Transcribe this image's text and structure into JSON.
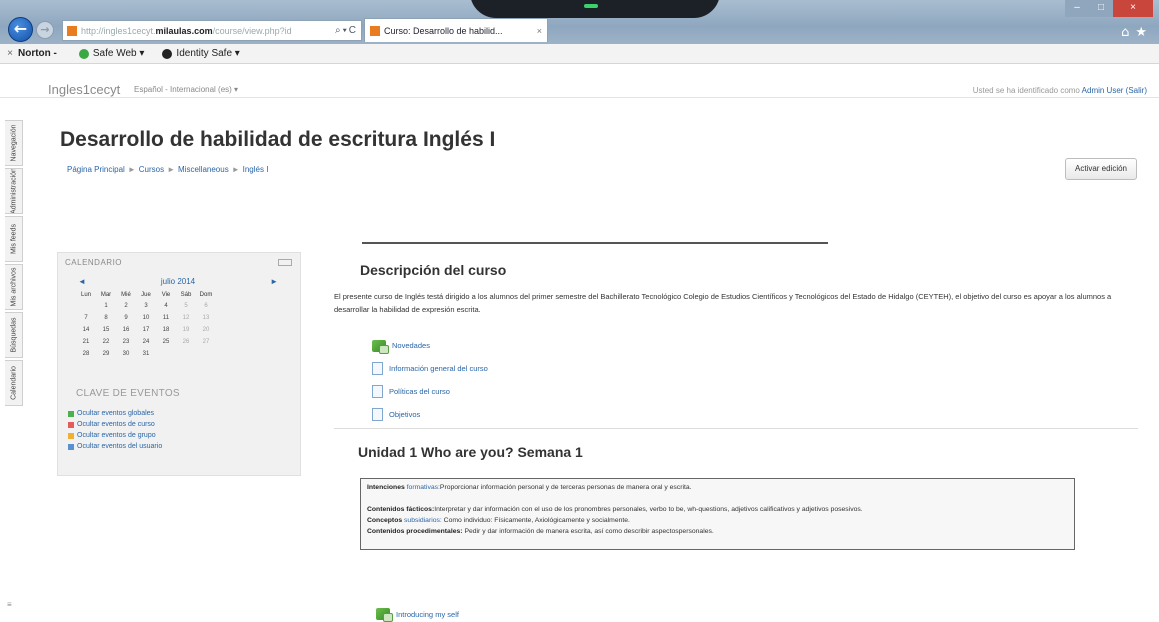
{
  "browser": {
    "address": {
      "scheme": "http://",
      "host_pre": "ingles1cecyt.",
      "host": "milaulas.com",
      "path": "/course/view.php?id"
    },
    "tab_title": "Curso: Desarrollo de habilid...",
    "toolbar": {
      "norton_label": "Norton -",
      "safe_web_label": "Safe Web ▾",
      "identity_safe_label": "Identity Safe ▾"
    }
  },
  "site": {
    "name": "Ingles1cecyt",
    "language": "Español - Internacional (es) ▾",
    "login_text": "Usted se ha identificado como ",
    "login_user": "Admin User (Salir)"
  },
  "dock": {
    "items": [
      "Navegación",
      "Administración",
      "Mis feeds",
      "Mis archivos",
      "Búsquedas",
      "Calendario"
    ],
    "bottom": "≡"
  },
  "course": {
    "title": "Desarrollo de habilidad de escritura Inglés I",
    "breadcrumb": [
      "Página Principal",
      "Cursos",
      "Miscellaneous",
      "Inglés I"
    ],
    "edit_button": "Activar edición"
  },
  "calendar": {
    "header": "CALENDARIO",
    "prev": "◄",
    "month": "julio 2014",
    "next": "►",
    "weekdays": [
      "Lun",
      "Mar",
      "Mié",
      "Jue",
      "Vie",
      "Sáb",
      "Dom"
    ],
    "weeks": [
      [
        "",
        "1",
        "2",
        "3",
        "4",
        "5",
        "6"
      ],
      [
        "7",
        "8",
        "9",
        "10",
        "11",
        "12",
        "13"
      ],
      [
        "14",
        "15",
        "16",
        "17",
        "18",
        "19",
        "20"
      ],
      [
        "21",
        "22",
        "23",
        "24",
        "25",
        "26",
        "27"
      ],
      [
        "28",
        "29",
        "30",
        "31",
        "",
        "",
        ""
      ]
    ],
    "events_title": "CLAVE DE EVENTOS",
    "events": [
      {
        "label": "Ocultar eventos globales",
        "color": "#4caf50"
      },
      {
        "label": "Ocultar eventos de curso",
        "color": "#e65a5a"
      },
      {
        "label": "Ocultar eventos de grupo",
        "color": "#f0b030"
      },
      {
        "label": "Ocultar eventos del usuario",
        "color": "#5a8fd0"
      }
    ]
  },
  "section0": {
    "title": "Descripción del curso",
    "description": "El presente curso de Inglés testá dirigido a los alumnos del primer semestre del Bachillerato Tecnológico Colegio de Estudios Científicos y Tecnológicos del Estado de Hidalgo (CEYTEH), el objetivo del curso es apoyar a los alumnos a desarrollar la habilidad de expresión escrita.",
    "resources": [
      {
        "label": "Novedades",
        "icon": "forum"
      },
      {
        "label": "Información general del curso",
        "icon": "page"
      },
      {
        "label": "Políticas del curso",
        "icon": "page"
      },
      {
        "label": "Objetivos",
        "icon": "page"
      }
    ]
  },
  "section1": {
    "title": "Unidad 1 Who are you? Semana 1",
    "box": {
      "l1_bold": "Intenciones ",
      "l1_link": "formativas:",
      "l1_text": "Proporcionar información personal y de terceras personas de manera oral y escrita.",
      "l2_bold": "Contenidos fácticos:",
      "l2_text": "Interpretar y dar información con el uso de los pronombres personales, verbo to be, wh-questions, adjetivos calificativos y adjetivos posesivos.",
      "l3_bold": "Conceptos ",
      "l3_link": "subsidiarios:",
      "l3_text": " Como individuo: Físicamente, Axiológicamente y socialmente.",
      "l4_bold": "Contenidos procedimentales:",
      "l4_text": " Pedir y dar información de manera escrita, así como describir aspectospersonales."
    },
    "last_item": "Introducing my self"
  }
}
